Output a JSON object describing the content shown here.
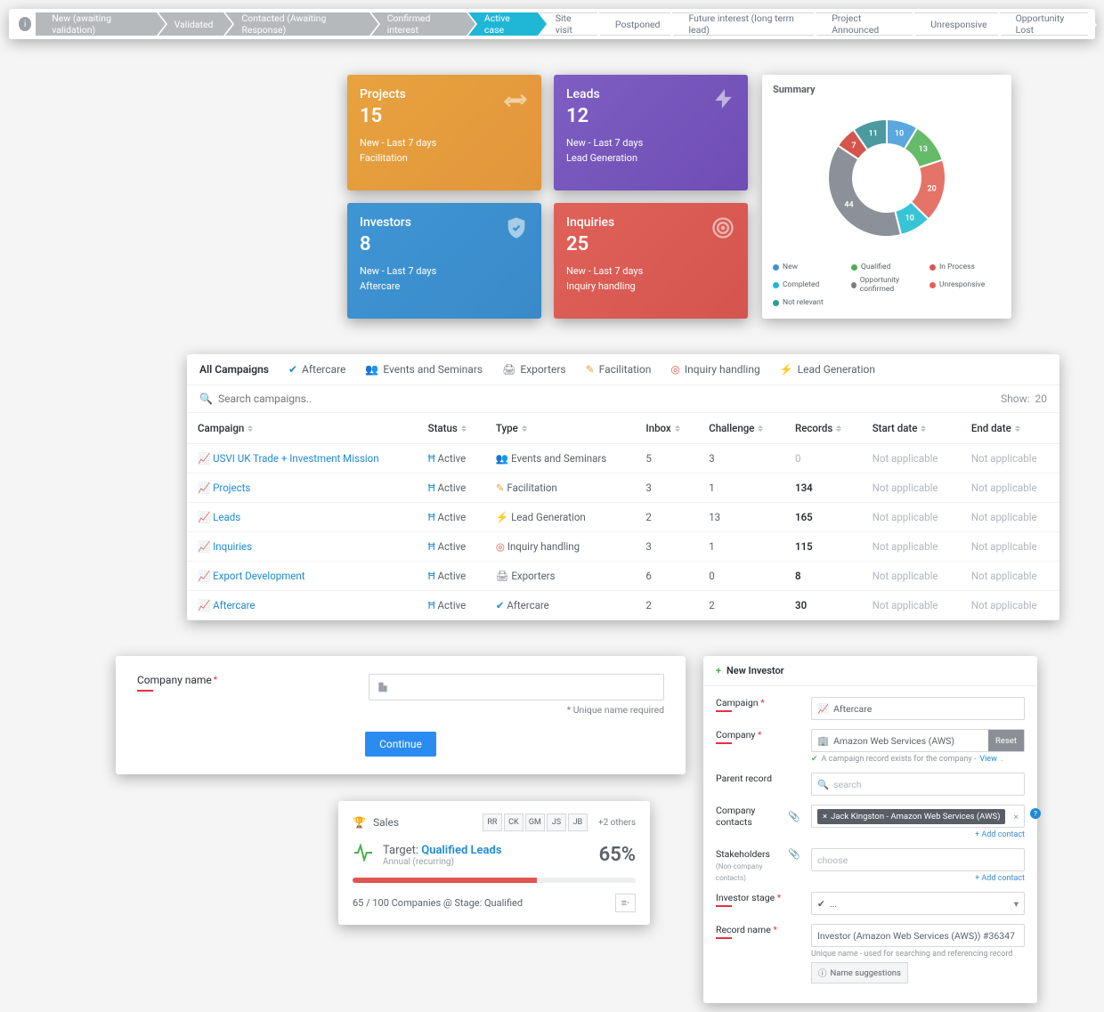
{
  "pipeline": {
    "stages": [
      "New (awaiting validation)",
      "Validated",
      "Contacted (Awaiting Response)",
      "Confirmed interest",
      "Active case",
      "Site visit",
      "Postponed",
      "Future interest (long term lead)",
      "Project Announced",
      "Unresponsive",
      "Opportunity Lost"
    ],
    "active_index": 4
  },
  "metrics": {
    "projects": {
      "title": "Projects",
      "value": "15",
      "sub1": "New - Last 7 days",
      "sub2": "Facilitation"
    },
    "leads": {
      "title": "Leads",
      "value": "12",
      "sub1": "New - Last 7 days",
      "sub2": "Lead Generation"
    },
    "investors": {
      "title": "Investors",
      "value": "8",
      "sub1": "New - Last 7 days",
      "sub2": "Aftercare"
    },
    "inquiries": {
      "title": "Inquiries",
      "value": "25",
      "sub1": "New - Last 7 days",
      "sub2": "Inquiry handling"
    }
  },
  "summary": {
    "title": "Summary",
    "legend": [
      {
        "label": "New",
        "color": "#3f95d4"
      },
      {
        "label": "Qualified",
        "color": "#4caf50"
      },
      {
        "label": "In Process",
        "color": "#e05550"
      },
      {
        "label": "Completed",
        "color": "#20b6d6"
      },
      {
        "label": "Opportunity confirmed",
        "color": "#7a7f86"
      },
      {
        "label": "Unresponsive",
        "color": "#df6158"
      },
      {
        "label": "Not relevant",
        "color": "#2a9d8f"
      }
    ]
  },
  "chart_data": {
    "type": "pie",
    "title": "Summary",
    "series": [
      {
        "name": "New",
        "value": 10,
        "color": "#5aa8de"
      },
      {
        "name": "Qualified",
        "value": 13,
        "color": "#66bb6a"
      },
      {
        "name": "In Process",
        "value": 20,
        "color": "#e57368"
      },
      {
        "name": "Completed",
        "value": 10,
        "color": "#38c4d6"
      },
      {
        "name": "Opportunity confirmed",
        "value": 44,
        "color": "#8c9199"
      },
      {
        "name": "Unresponsive",
        "value": 7,
        "color": "#d4554e"
      },
      {
        "name": "Not relevant",
        "value": 11,
        "color": "#4a9aa0"
      }
    ]
  },
  "campaigns": {
    "tabs": [
      "All Campaigns",
      "Aftercare",
      "Events and Seminars",
      "Exporters",
      "Facilitation",
      "Inquiry handling",
      "Lead Generation"
    ],
    "search_placeholder": "Search campaigns..",
    "show_label": "Show:",
    "show_value": "20",
    "columns": [
      "Campaign",
      "Status",
      "Type",
      "Inbox",
      "Challenge",
      "Records",
      "Start date",
      "End date"
    ],
    "rows": [
      {
        "campaign": "USVI UK Trade + Investment Mission",
        "status": "Active",
        "type": "Events and Seminars",
        "type_color": "#7a7f86",
        "inbox": "5",
        "challenge": "3",
        "records": "0",
        "start": "Not applicable",
        "end": "Not applicable"
      },
      {
        "campaign": "Projects",
        "status": "Active",
        "type": "Facilitation",
        "type_color": "#e8a23f",
        "inbox": "3",
        "challenge": "1",
        "records": "134",
        "start": "Not applicable",
        "end": "Not applicable"
      },
      {
        "campaign": "Leads",
        "status": "Active",
        "type": "Lead Generation",
        "type_color": "#7e5ec2",
        "inbox": "2",
        "challenge": "13",
        "records": "165",
        "start": "Not applicable",
        "end": "Not applicable"
      },
      {
        "campaign": "Inquiries",
        "status": "Active",
        "type": "Inquiry handling",
        "type_color": "#e05550",
        "inbox": "3",
        "challenge": "1",
        "records": "115",
        "start": "Not applicable",
        "end": "Not applicable"
      },
      {
        "campaign": "Export Development",
        "status": "Active",
        "type": "Exporters",
        "type_color": "#7a7f86",
        "inbox": "6",
        "challenge": "0",
        "records": "8",
        "start": "Not applicable",
        "end": "Not applicable"
      },
      {
        "campaign": "Aftercare",
        "status": "Active",
        "type": "Aftercare",
        "type_color": "#1f8ad4",
        "inbox": "2",
        "challenge": "2",
        "records": "30",
        "start": "Not applicable",
        "end": "Not applicable"
      }
    ]
  },
  "company_form": {
    "label": "Company name",
    "hint": "* Unique name required",
    "continue": "Continue"
  },
  "sales": {
    "title": "Sales",
    "avatars": [
      "RR",
      "CK",
      "GM",
      "JS",
      "JB"
    ],
    "others": "+2 others",
    "target_label": "Target:",
    "target_value": "Qualified Leads",
    "subtitle": "Annual (recurring)",
    "pct": "65%",
    "progress_pct": 65,
    "status": "65 / 100 Companies @ Stage: Qualified"
  },
  "investor": {
    "header": "New Investor",
    "fields": {
      "campaign": {
        "label": "Campaign",
        "value": "Aftercare"
      },
      "company": {
        "label": "Company",
        "value": "Amazon Web Services (AWS)",
        "reset": "Reset",
        "note": "A campaign record exists for the company -",
        "view": "View"
      },
      "parent": {
        "label": "Parent record",
        "placeholder": "search"
      },
      "contacts": {
        "label": "Company contacts",
        "chip": "Jack Kingston - Amazon Web Services (AWS)",
        "add": "+ Add contact"
      },
      "stakeholders": {
        "label": "Stakeholders",
        "label_sub": "(Non-company contacts)",
        "placeholder": "choose",
        "add": "+ Add contact"
      },
      "stage": {
        "label": "Investor stage",
        "value": "..."
      },
      "record": {
        "label": "Record name",
        "value": "Investor (Amazon Web Services (AWS)) #36347",
        "hint": "Unique name - used for searching and referencing record",
        "suggest": "Name suggestions"
      }
    }
  }
}
